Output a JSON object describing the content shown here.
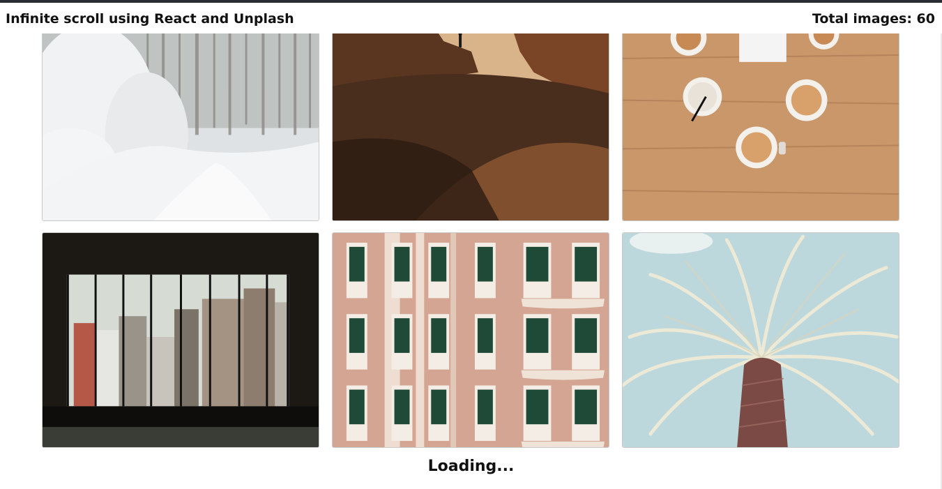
{
  "header": {
    "title": "Infinite scroll using React and Unplash",
    "total_label": "Total images: 60"
  },
  "gallery": {
    "images": [
      {
        "subject": "snowy-forest",
        "colors": {
          "sky": "#e9ecef",
          "trees": "#c9ccc9",
          "snow": "#f4f5f6"
        }
      },
      {
        "subject": "desert-canyon-hiker",
        "colors": {
          "sky": "#d9b48a",
          "rock": "#6b3e22",
          "shadow": "#2c1b12"
        }
      },
      {
        "subject": "coffee-cups-on-wood",
        "colors": {
          "wood": "#c28f5e",
          "foam": "#d8a06a",
          "cup": "#f4f1ec"
        }
      },
      {
        "subject": "city-view-window",
        "colors": {
          "frame": "#1c1914",
          "sky": "#d6dcd3",
          "buildings": "#8c7d6e"
        }
      },
      {
        "subject": "pink-building-facade",
        "colors": {
          "wall": "#d4a592",
          "trim": "#eeddd1",
          "shutters": "#1f4a37"
        }
      },
      {
        "subject": "palm-tree",
        "colors": {
          "sky": "#bcd8dc",
          "fronds": "#eae8d6",
          "trunk": "#7c4a45"
        }
      }
    ]
  },
  "status": {
    "loading_text": "Loading..."
  }
}
